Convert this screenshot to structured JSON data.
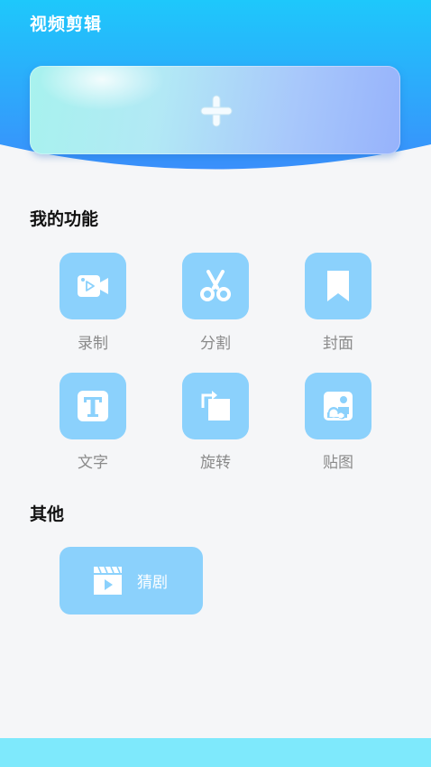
{
  "app": {
    "title": "视频剪辑"
  },
  "add_card": {
    "icon": "plus-icon"
  },
  "sections": {
    "my_functions": {
      "title": "我的功能",
      "items": [
        {
          "label": "录制",
          "icon": "video-camera-icon"
        },
        {
          "label": "分割",
          "icon": "scissors-icon"
        },
        {
          "label": "封面",
          "icon": "bookmark-icon"
        },
        {
          "label": "文字",
          "icon": "text-icon"
        },
        {
          "label": "旋转",
          "icon": "rotate-icon"
        },
        {
          "label": "贴图",
          "icon": "sticker-image-icon"
        }
      ]
    },
    "others": {
      "title": "其他",
      "items": [
        {
          "label": "猜剧",
          "icon": "clapperboard-play-icon"
        }
      ]
    }
  },
  "colors": {
    "header_top": "#1ec8fb",
    "header_bottom": "#3a8ffb",
    "tile": "#8bd1fc",
    "background": "#f5f6f8",
    "bottom_bar": "#7ee9fc"
  }
}
